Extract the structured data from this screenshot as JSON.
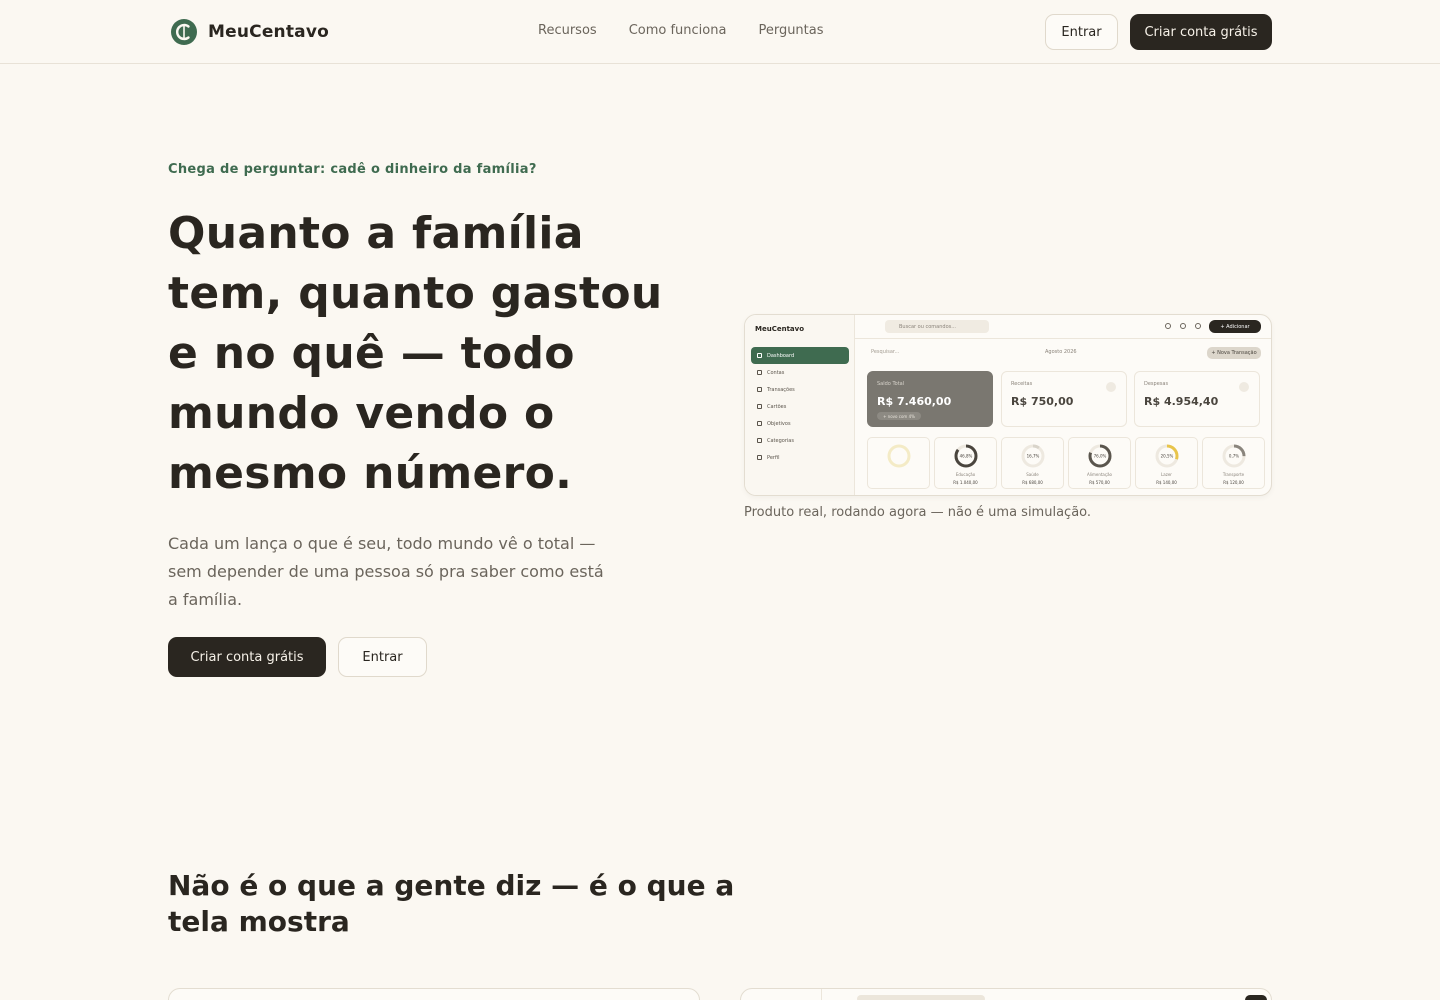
{
  "header": {
    "brand": "MeuCentavo",
    "nav": [
      "Recursos",
      "Como funciona",
      "Perguntas"
    ],
    "login": "Entrar",
    "signup": "Criar conta grátis"
  },
  "hero": {
    "eyebrow": "Chega de perguntar: cadê o dinheiro da família?",
    "title": "Quanto a família tem, quanto gastou e no quê — todo mundo vendo o mesmo número.",
    "subtitle": "Cada um lança o que é seu, todo mundo vê o total — sem depender de uma pessoa só pra saber como está a família.",
    "cta_primary": "Criar conta grátis",
    "cta_secondary": "Entrar"
  },
  "mockup": {
    "brand": "MeuCentavo",
    "search_placeholder": "Buscar ou comandos...",
    "add_label": "+ Adicionar",
    "nav": [
      "Dashboard",
      "Contas",
      "Transações",
      "Cartões",
      "Objetivos",
      "Categorias",
      "Perfil"
    ],
    "filter_placeholder": "Pesquisar...",
    "month": "Agosto 2026",
    "new_transaction": "+ Nova Transação",
    "cards": [
      {
        "label": "Saldo Total",
        "value": "R$ 7.460,00",
        "badge": "+ novo com 4%"
      },
      {
        "label": "Receitas",
        "value": "R$ 750,00"
      },
      {
        "label": "Despesas",
        "value": "R$ 4.954,40"
      }
    ],
    "rings": [
      {
        "pct": "",
        "name": "",
        "value": "",
        "fraction": 0.0
      },
      {
        "pct": "46,8%",
        "name": "Educação",
        "value": "R$ 1.040,00",
        "fraction": 0.85
      },
      {
        "pct": "16,7%",
        "name": "Saúde",
        "value": "R$ 680,00",
        "fraction": 0.1
      },
      {
        "pct": "76,0%",
        "name": "Alimentação",
        "value": "R$ 570,00",
        "fraction": 0.8
      },
      {
        "pct": "20,5%",
        "name": "Lazer",
        "value": "R$ 140,00",
        "fraction": 0.3
      },
      {
        "pct": "0,7%",
        "name": "Transporte",
        "value": "R$ 120,00",
        "fraction": 0.25
      }
    ],
    "caption": "Produto real, rodando agora — não é uma simulação."
  },
  "section2": {
    "title": "Não é o que a gente diz — é o que a tela mostra"
  },
  "colors": {
    "accent": "#3f6b50",
    "dark": "#2a2620",
    "background": "#fbf8f2"
  }
}
